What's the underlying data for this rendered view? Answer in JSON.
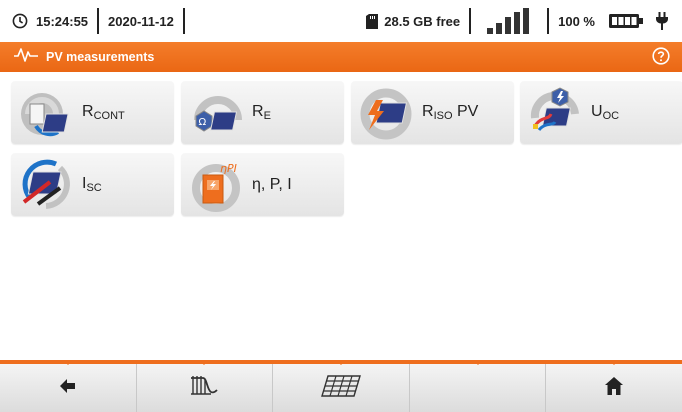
{
  "status": {
    "time": "15:24:55",
    "date": "2020-11-12",
    "storage": "28.5 GB free",
    "battery_percent": "100 %",
    "signal_level": 4,
    "icons": [
      "clock-icon",
      "sd-card-icon",
      "signal-icon",
      "battery-icon",
      "plug-icon"
    ]
  },
  "header": {
    "title": "PV measurements",
    "icons": [
      "waveform-icon",
      "help-icon"
    ]
  },
  "tiles": [
    {
      "main": "R",
      "sub": "CONT",
      "icon": "continuity-icon"
    },
    {
      "main": "R",
      "sub": "E",
      "icon": "earth-resistance-icon"
    },
    {
      "main": "R",
      "sub": "ISO",
      "suffix": " PV",
      "icon": "insulation-icon"
    },
    {
      "main": "U",
      "sub": "OC",
      "icon": "open-circuit-voltage-icon"
    },
    {
      "main": "I",
      "sub": "SC",
      "icon": "short-circuit-current-icon"
    },
    {
      "label": "η, P, I",
      "icon": "efficiency-icon"
    }
  ],
  "toolbar": {
    "buttons": [
      {
        "icon": "back-arrow-icon"
      },
      {
        "icon": "iv-curve-icon"
      },
      {
        "icon": "solar-panel-icon"
      },
      {
        "icon": "empty"
      },
      {
        "icon": "home-icon"
      }
    ]
  },
  "colors": {
    "accent": "#ee6e1e",
    "tile_bg": "#ececec",
    "bar_bg": "#e6e6e6"
  }
}
